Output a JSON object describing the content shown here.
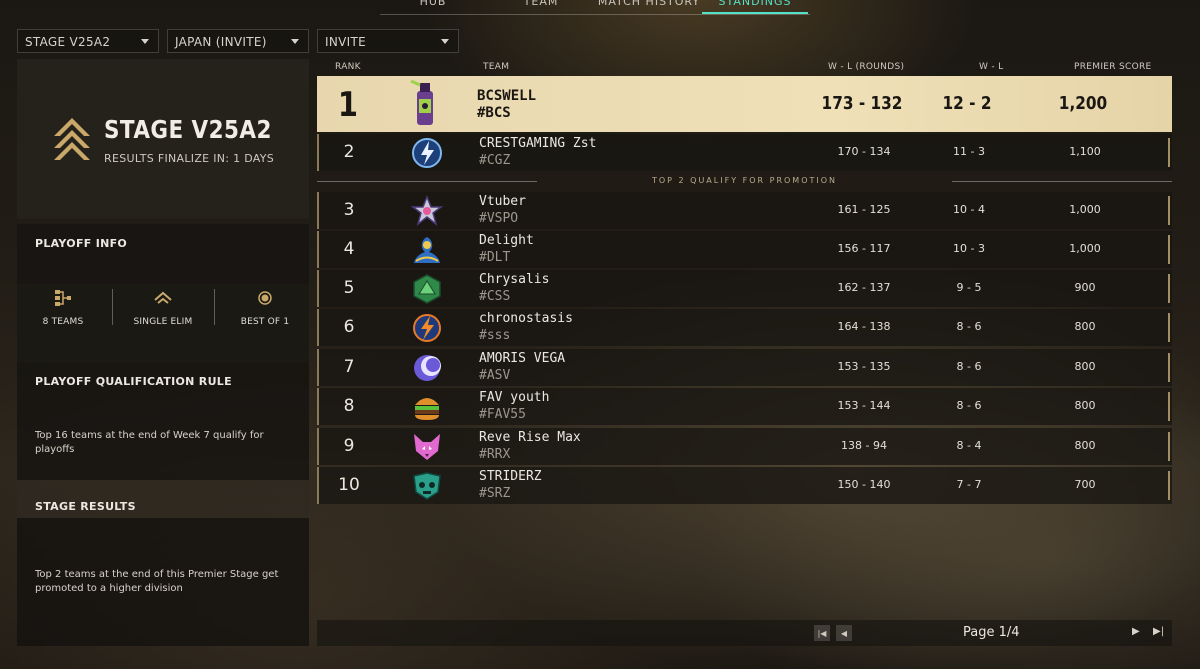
{
  "nav": {
    "tabs": [
      {
        "label": "HUB"
      },
      {
        "label": "TEAM"
      },
      {
        "label": "MATCH HISTORY"
      },
      {
        "label": "STANDINGS",
        "active": true
      }
    ]
  },
  "filters": {
    "stage": "STAGE V25A2",
    "region": "JAPAN (INVITE)",
    "division": "INVITE"
  },
  "stage": {
    "title": "STAGE V25A2",
    "subtitle": "RESULTS FINALIZE IN: 1 DAYS"
  },
  "playoff": {
    "title": "PLAYOFF INFO",
    "stats": [
      {
        "label": "8 TEAMS",
        "icon": "bracket-icon"
      },
      {
        "label": "SINGLE ELIM",
        "icon": "chevron-up-icon"
      },
      {
        "label": "BEST OF 1",
        "icon": "circle-icon"
      }
    ],
    "rule_title": "PLAYOFF QUALIFICATION RULE",
    "rule_text": "Top 16 teams at the end of Week 7 qualify for playoffs",
    "results_title": "STAGE RESULTS",
    "results_text": "Top 2 teams at the end of this Premier Stage get promoted to a higher division"
  },
  "table": {
    "headers": {
      "rank": "RANK",
      "team": "TEAM",
      "rounds": "W - L (ROUNDS)",
      "wl": "W - L",
      "score": "PREMIER SCORE"
    },
    "promo_text": "TOP 2 QUALIFY FOR PROMOTION",
    "rows": [
      {
        "rank": "1",
        "name": "BCSWELL",
        "tag": "#BCS",
        "rounds": "173 - 132",
        "wl": "12 - 2",
        "score": "1,200",
        "logo": "spray-can-logo"
      },
      {
        "rank": "2",
        "name": "CRESTGAMING Zst",
        "tag": "#CGZ",
        "rounds": "170 - 134",
        "wl": "11 - 3",
        "score": "1,100",
        "logo": "lightning-logo"
      },
      {
        "rank": "3",
        "name": "Vtuber",
        "tag": "#VSPO",
        "rounds": "161 - 125",
        "wl": "10 - 4",
        "score": "1,000",
        "logo": "star-logo"
      },
      {
        "rank": "4",
        "name": "Delight",
        "tag": "#DLT",
        "rounds": "156 - 117",
        "wl": "10 - 3",
        "score": "1,000",
        "logo": "genie-logo"
      },
      {
        "rank": "5",
        "name": "Chrysalis",
        "tag": "#CSS",
        "rounds": "162 - 137",
        "wl": "9 - 5",
        "score": "900",
        "logo": "d20-logo"
      },
      {
        "rank": "6",
        "name": "chronostasis",
        "tag": "#sss",
        "rounds": "164 - 138",
        "wl": "8 - 6",
        "score": "800",
        "logo": "bolt-logo"
      },
      {
        "rank": "7",
        "name": "AMORIS VEGA",
        "tag": "#ASV",
        "rounds": "153 - 135",
        "wl": "8 - 6",
        "score": "800",
        "logo": "crescent-logo"
      },
      {
        "rank": "8",
        "name": "FAV youth",
        "tag": "#FAV55",
        "rounds": "153 - 144",
        "wl": "8 - 6",
        "score": "800",
        "logo": "burger-logo"
      },
      {
        "rank": "9",
        "name": "Reve Rise Max",
        "tag": "#RRX",
        "rounds": "138 - 94",
        "wl": "8 - 4",
        "score": "800",
        "logo": "fox-logo"
      },
      {
        "rank": "10",
        "name": "STRIDERZ",
        "tag": "#SRZ",
        "rounds": "150 - 140",
        "wl": "7 - 7",
        "score": "700",
        "logo": "skull-logo"
      }
    ]
  },
  "pager": {
    "label": "Page 1/4"
  }
}
